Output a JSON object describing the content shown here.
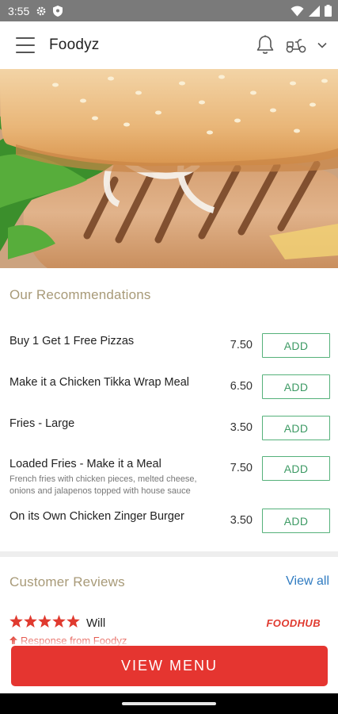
{
  "status_bar": {
    "time": "3:55",
    "icons": [
      "settings-gear-icon",
      "shield-icon",
      "wifi-icon",
      "signal-icon",
      "battery-icon"
    ]
  },
  "app_bar": {
    "title": "Foodyz",
    "icons": [
      "hamburger-menu-icon",
      "bell-icon",
      "scooter-icon",
      "chevron-down-icon"
    ]
  },
  "recommendations": {
    "title": "Our Recommendations",
    "add_label": "ADD",
    "items": [
      {
        "name": "Buy 1 Get 1 Free Pizzas",
        "description": "",
        "price": "7.50"
      },
      {
        "name": "Make it a Chicken Tikka Wrap Meal",
        "description": "",
        "price": "6.50"
      },
      {
        "name": "Fries - Large",
        "description": "",
        "price": "3.50"
      },
      {
        "name": "Loaded Fries - Make it a Meal",
        "description": "French fries with chicken pieces, melted cheese, onions and jalapenos topped with house sauce",
        "price": "7.50"
      },
      {
        "name": "On its Own Chicken Zinger Burger",
        "description": "",
        "price": "3.50"
      }
    ]
  },
  "reviews": {
    "title": "Customer Reviews",
    "view_all": "View all",
    "first_review": {
      "rating": 5,
      "reviewer": "Will",
      "brand": "FOODHUB",
      "response": "Response from Foodyz"
    }
  },
  "colors": {
    "accent_red": "#e53530",
    "add_green": "#55b17a",
    "section_title": "#a89a78",
    "link_blue": "#2f7bc1"
  },
  "cta": {
    "label": "VIEW MENU"
  }
}
